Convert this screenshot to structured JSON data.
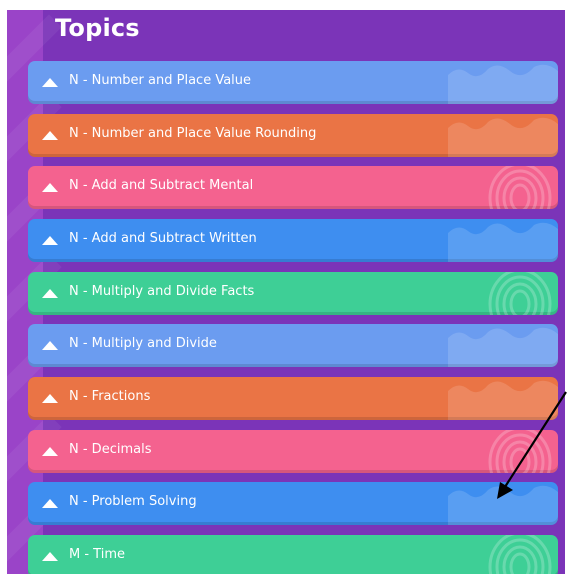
{
  "header": {
    "title": "Topics"
  },
  "topics": [
    {
      "label": "N - Number and Place Value",
      "color": "#6b9cf0",
      "deco": "wave-icon"
    },
    {
      "label": "N - Number and Place Value Rounding",
      "color": "#ea7445",
      "deco": "wave-icon"
    },
    {
      "label": "N - Add and Subtract Mental",
      "color": "#f4628f",
      "deco": "spiral-icon"
    },
    {
      "label": "N - Add and Subtract Written",
      "color": "#3e8ef0",
      "deco": "wave-icon"
    },
    {
      "label": "N - Multiply and Divide Facts",
      "color": "#3ecf96",
      "deco": "spiral-icon"
    },
    {
      "label": "N - Multiply and Divide",
      "color": "#6b9cf0",
      "deco": "wave-icon"
    },
    {
      "label": "N - Fractions",
      "color": "#ea7445",
      "deco": "wave-icon"
    },
    {
      "label": "N - Decimals",
      "color": "#f4628f",
      "deco": "spiral-icon"
    },
    {
      "label": "N - Problem Solving",
      "color": "#3e8ef0",
      "deco": "wave-icon"
    },
    {
      "label": "M - Time",
      "color": "#3ecf96",
      "deco": "spiral-icon"
    }
  ],
  "colors": {
    "panel": "#7b34b8",
    "strip": "#9a44c8",
    "annotation_arrow": "#000000"
  }
}
